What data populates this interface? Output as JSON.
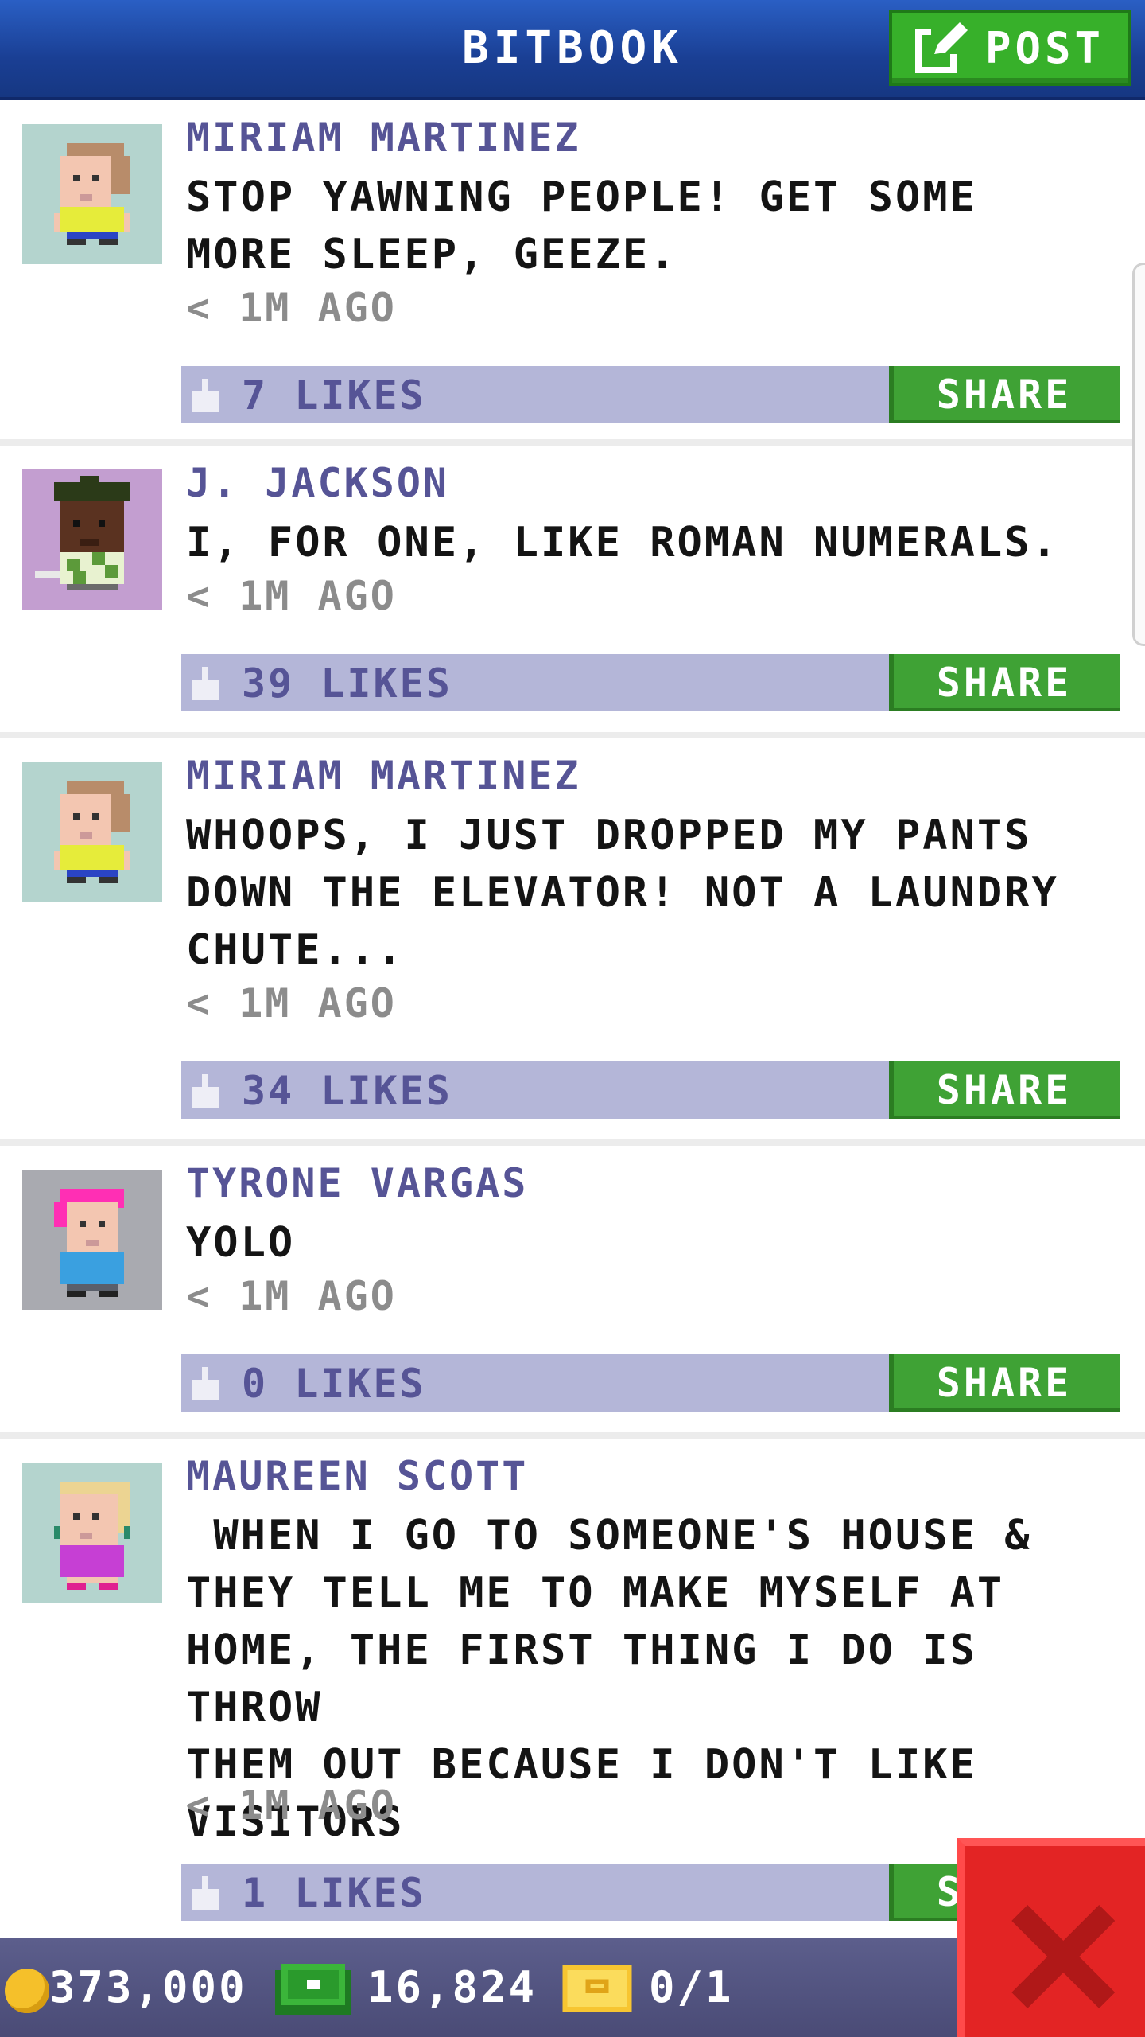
{
  "header": {
    "title": "BITBOOK",
    "post_label": "POST"
  },
  "posts": [
    {
      "author": "MIRIAM MARTINEZ",
      "text": "STOP YAWNING PEOPLE! GET SOME\nMORE SLEEP, GEEZE.",
      "time": "< 1M AGO",
      "likes": "7 LIKES",
      "share": "SHARE",
      "avatar": "miriam"
    },
    {
      "author": "J. JACKSON",
      "text": "I, FOR ONE, LIKE ROMAN NUMERALS.",
      "time": "< 1M AGO",
      "likes": "39 LIKES",
      "share": "SHARE",
      "avatar": "jackson"
    },
    {
      "author": "MIRIAM MARTINEZ",
      "text": "WHOOPS, I JUST DROPPED MY PANTS\nDOWN THE ELEVATOR! NOT A LAUNDRY\nCHUTE...",
      "time": "< 1M AGO",
      "likes": "34 LIKES",
      "share": "SHARE",
      "avatar": "miriam"
    },
    {
      "author": "TYRONE VARGAS",
      "text": "YOLO",
      "time": "< 1M AGO",
      "likes": "0 LIKES",
      "share": "SHARE",
      "avatar": "tyrone"
    },
    {
      "author": "MAUREEN SCOTT",
      "text": " WHEN I GO TO SOMEONE'S HOUSE &\nTHEY TELL ME TO MAKE MYSELF AT\nHOME, THE FIRST THING I DO IS THROW\nTHEM OUT BECAUSE I DON'T LIKE\nVISITORS",
      "time": "< 1M AGO",
      "likes": "1 LIKES",
      "share": "SHARE",
      "avatar": "maureen"
    }
  ],
  "footer": {
    "coins": "373,000",
    "bux": "16,824",
    "tickets": "0/1"
  },
  "icons": [
    "edit-icon",
    "thumbs-up-icon",
    "coin-icon",
    "cash-icon",
    "ticket-icon",
    "close-icon"
  ],
  "colors": {
    "header_blue": "#1a3f94",
    "share_green": "#3fa235",
    "like_bar": "#b4b6d8",
    "name_purple": "#565496",
    "close_red": "#e32424"
  }
}
